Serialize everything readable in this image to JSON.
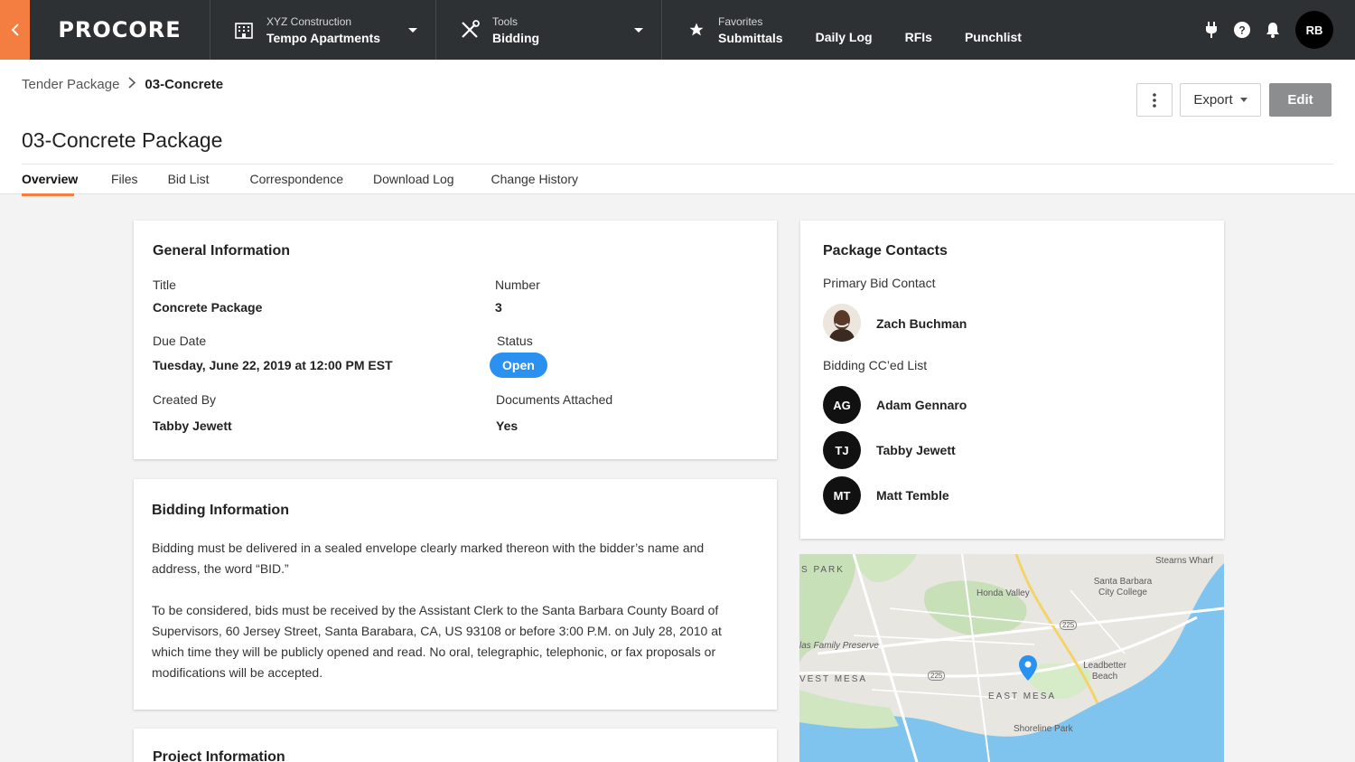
{
  "nav": {
    "logo": "PROCORE",
    "project": {
      "company": "XYZ Construction",
      "name": "Tempo Apartments"
    },
    "tools": {
      "label": "Tools",
      "current": "Bidding"
    },
    "favorites": {
      "label": "Favorites",
      "items": [
        "Submittals",
        "Daily Log",
        "RFIs",
        "Punchlist"
      ]
    },
    "user_initials": "RB"
  },
  "breadcrumb": {
    "parent": "Tender Package",
    "current": "03-Concrete"
  },
  "page_title": "03-Concrete Package",
  "actions": {
    "export": "Export",
    "edit": "Edit"
  },
  "tabs": [
    "Overview",
    "Files",
    "Bid List",
    "Correspondence",
    "Download Log",
    "Change History"
  ],
  "general": {
    "heading": "General Information",
    "title_label": "Title",
    "title_value": "Concrete Package",
    "number_label": "Number",
    "number_value": "3",
    "due_label": "Due Date",
    "due_value": "Tuesday, June 22, 2019 at 12:00 PM EST",
    "status_label": "Status",
    "status_value": "Open",
    "created_label": "Created By",
    "created_value": "Tabby Jewett",
    "docs_label": "Documents Attached",
    "docs_value": "Yes"
  },
  "bidding": {
    "heading": "Bidding Information",
    "para1": "Bidding must be delivered in a sealed envelope clearly marked thereon with the bidder’s name and address, the word “BID.”",
    "para2": "To be considered, bids must be received by the Assistant Clerk to the Santa Barbara County Board of Supervisors, 60 Jersey Street, Santa Barabara, CA, US 93108 or before 3:00 P.M. on July 28, 2010 at which time they will be publicly opened and read. No oral, telegraphic, telephonic, or fax proposals or modifications will be accepted."
  },
  "project_info": {
    "heading": "Project Information"
  },
  "contacts": {
    "heading": "Package Contacts",
    "primary_label": "Primary Bid Contact",
    "primary_name": "Zach Buchman",
    "cc_label": "Bidding CC’ed List",
    "cc": [
      {
        "initials": "AG",
        "name": "Adam Gennaro"
      },
      {
        "initials": "TJ",
        "name": "Tabby Jewett"
      },
      {
        "initials": "MT",
        "name": "Matt Temble"
      }
    ]
  },
  "map": {
    "labels": {
      "s_park": "S PARK",
      "honda_valley": "Honda Valley",
      "stearns_wharf": "Stearns Wharf",
      "sbcc": "Santa Barbara City College",
      "las_family": "las Family Preserve",
      "west_mesa": "VEST MESA",
      "east_mesa": "EAST MESA",
      "leadbetter": "Leadbetter Beach",
      "shoreline": "Shoreline Park",
      "hwy": "225"
    }
  },
  "colors": {
    "brand": "#f47e42",
    "nav_bg": "#2d3134",
    "status": "#2a91f0",
    "edit_btn": "#8c8d8e"
  }
}
